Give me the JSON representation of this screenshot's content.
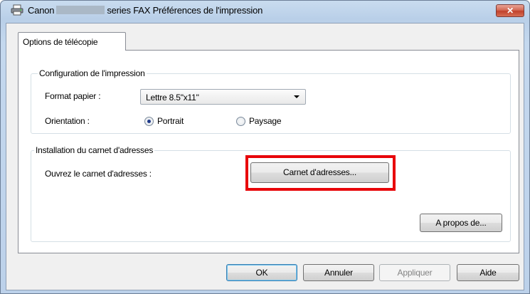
{
  "window": {
    "title_prefix": "Canon",
    "title_suffix": "series FAX Préférences de l'impression",
    "close_glyph": "✕"
  },
  "tabs": [
    {
      "label": "Options de télécopie"
    }
  ],
  "print_config": {
    "group_title": "Configuration de l'impression",
    "paper_size_label": "Format papier :",
    "paper_size_value": "Lettre 8.5\"x11\"",
    "orientation_label": "Orientation :",
    "portrait_label": "Portrait",
    "landscape_label": "Paysage",
    "orientation_selected": "Portrait"
  },
  "address_book": {
    "group_title": "Installation du carnet d'adresses",
    "open_label": "Ouvrez le carnet d'adresses :",
    "open_button": "Carnet d'adresses..."
  },
  "about_button": "A propos de...",
  "footer": {
    "ok": "OK",
    "cancel": "Annuler",
    "apply": "Appliquer",
    "help": "Aide"
  },
  "colors": {
    "highlight": "#e8050a",
    "radio_selected": "#1f3a8a"
  }
}
